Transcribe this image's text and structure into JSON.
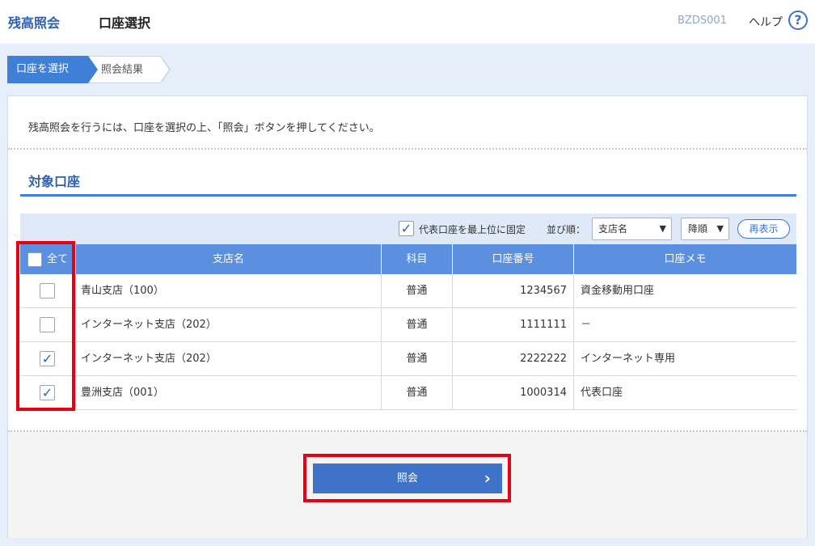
{
  "header": {
    "app_title": "残高照会",
    "page_title": "口座選択",
    "screen_id": "BZDS001",
    "help_label": "ヘルプ",
    "help_icon": "?"
  },
  "steps": [
    "口座を選択",
    "照会結果"
  ],
  "instruction": "残高照会を行うには、口座を選択の上、「照会」ボタンを押してください。",
  "section_title": "対象口座",
  "toolbar": {
    "pin_label": "代表口座を最上位に固定",
    "pin_checked": true,
    "sort_label": "並び順：",
    "sort_field": "支店名",
    "sort_order": "降順",
    "redisplay_label": "再表示"
  },
  "table": {
    "select_all_label": "全て",
    "columns": [
      "支店名",
      "科目",
      "口座番号",
      "口座メモ"
    ],
    "rows": [
      {
        "checked": false,
        "branch": "青山支店（100）",
        "type": "普通",
        "number": "1234567",
        "memo": "資金移動用口座"
      },
      {
        "checked": false,
        "branch": "インターネット支店（202）",
        "type": "普通",
        "number": "1111111",
        "memo": "－"
      },
      {
        "checked": true,
        "branch": "インターネット支店（202）",
        "type": "普通",
        "number": "2222222",
        "memo": "インターネット専用"
      },
      {
        "checked": true,
        "branch": "豊洲支店（001）",
        "type": "普通",
        "number": "1000314",
        "memo": "代表口座"
      }
    ]
  },
  "inquiry_button": "照会",
  "colors": {
    "accent": "#3f73c9",
    "highlight": "#e60012"
  }
}
